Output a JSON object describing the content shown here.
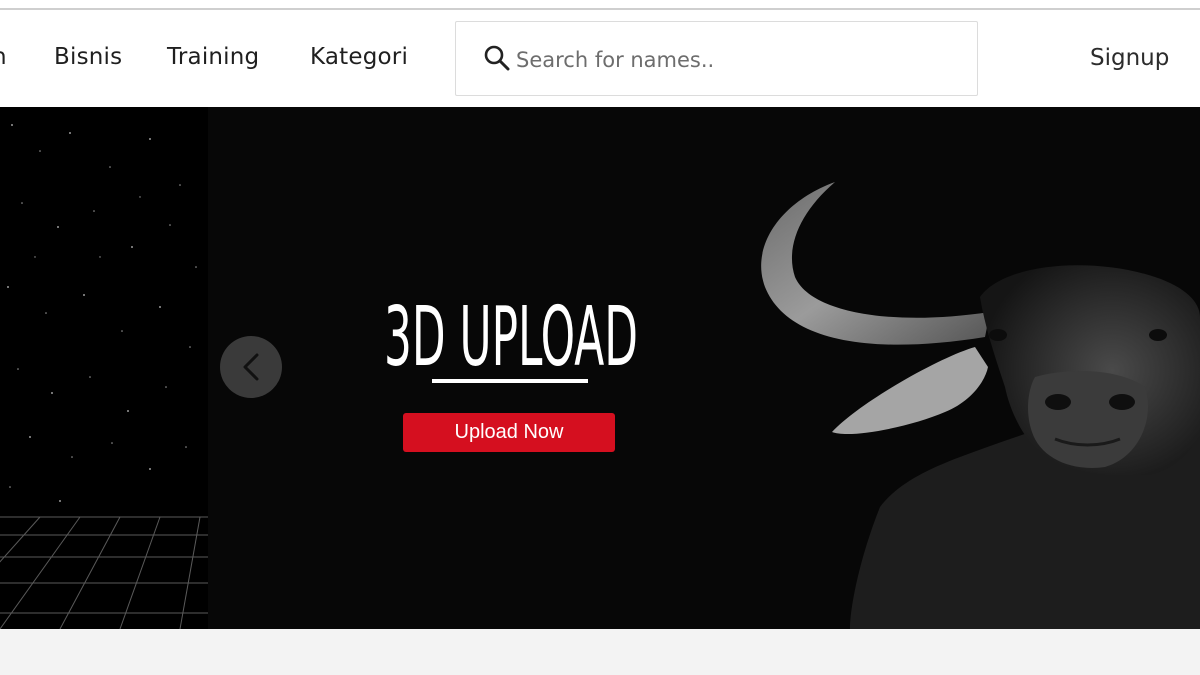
{
  "nav": {
    "clipped_item": "n",
    "items": [
      "Bisnis",
      "Training",
      "Kategori"
    ]
  },
  "search": {
    "placeholder": "Search for names..",
    "icon": "search-icon"
  },
  "auth": {
    "signup_label": "Signup"
  },
  "hero": {
    "title": "3D UPLOAD",
    "cta_label": "Upload Now",
    "prev_icon": "chevron-left-icon",
    "image": "water-buffalo-3d-render",
    "accent_color": "#d50f1f",
    "background_color": "#070707"
  }
}
